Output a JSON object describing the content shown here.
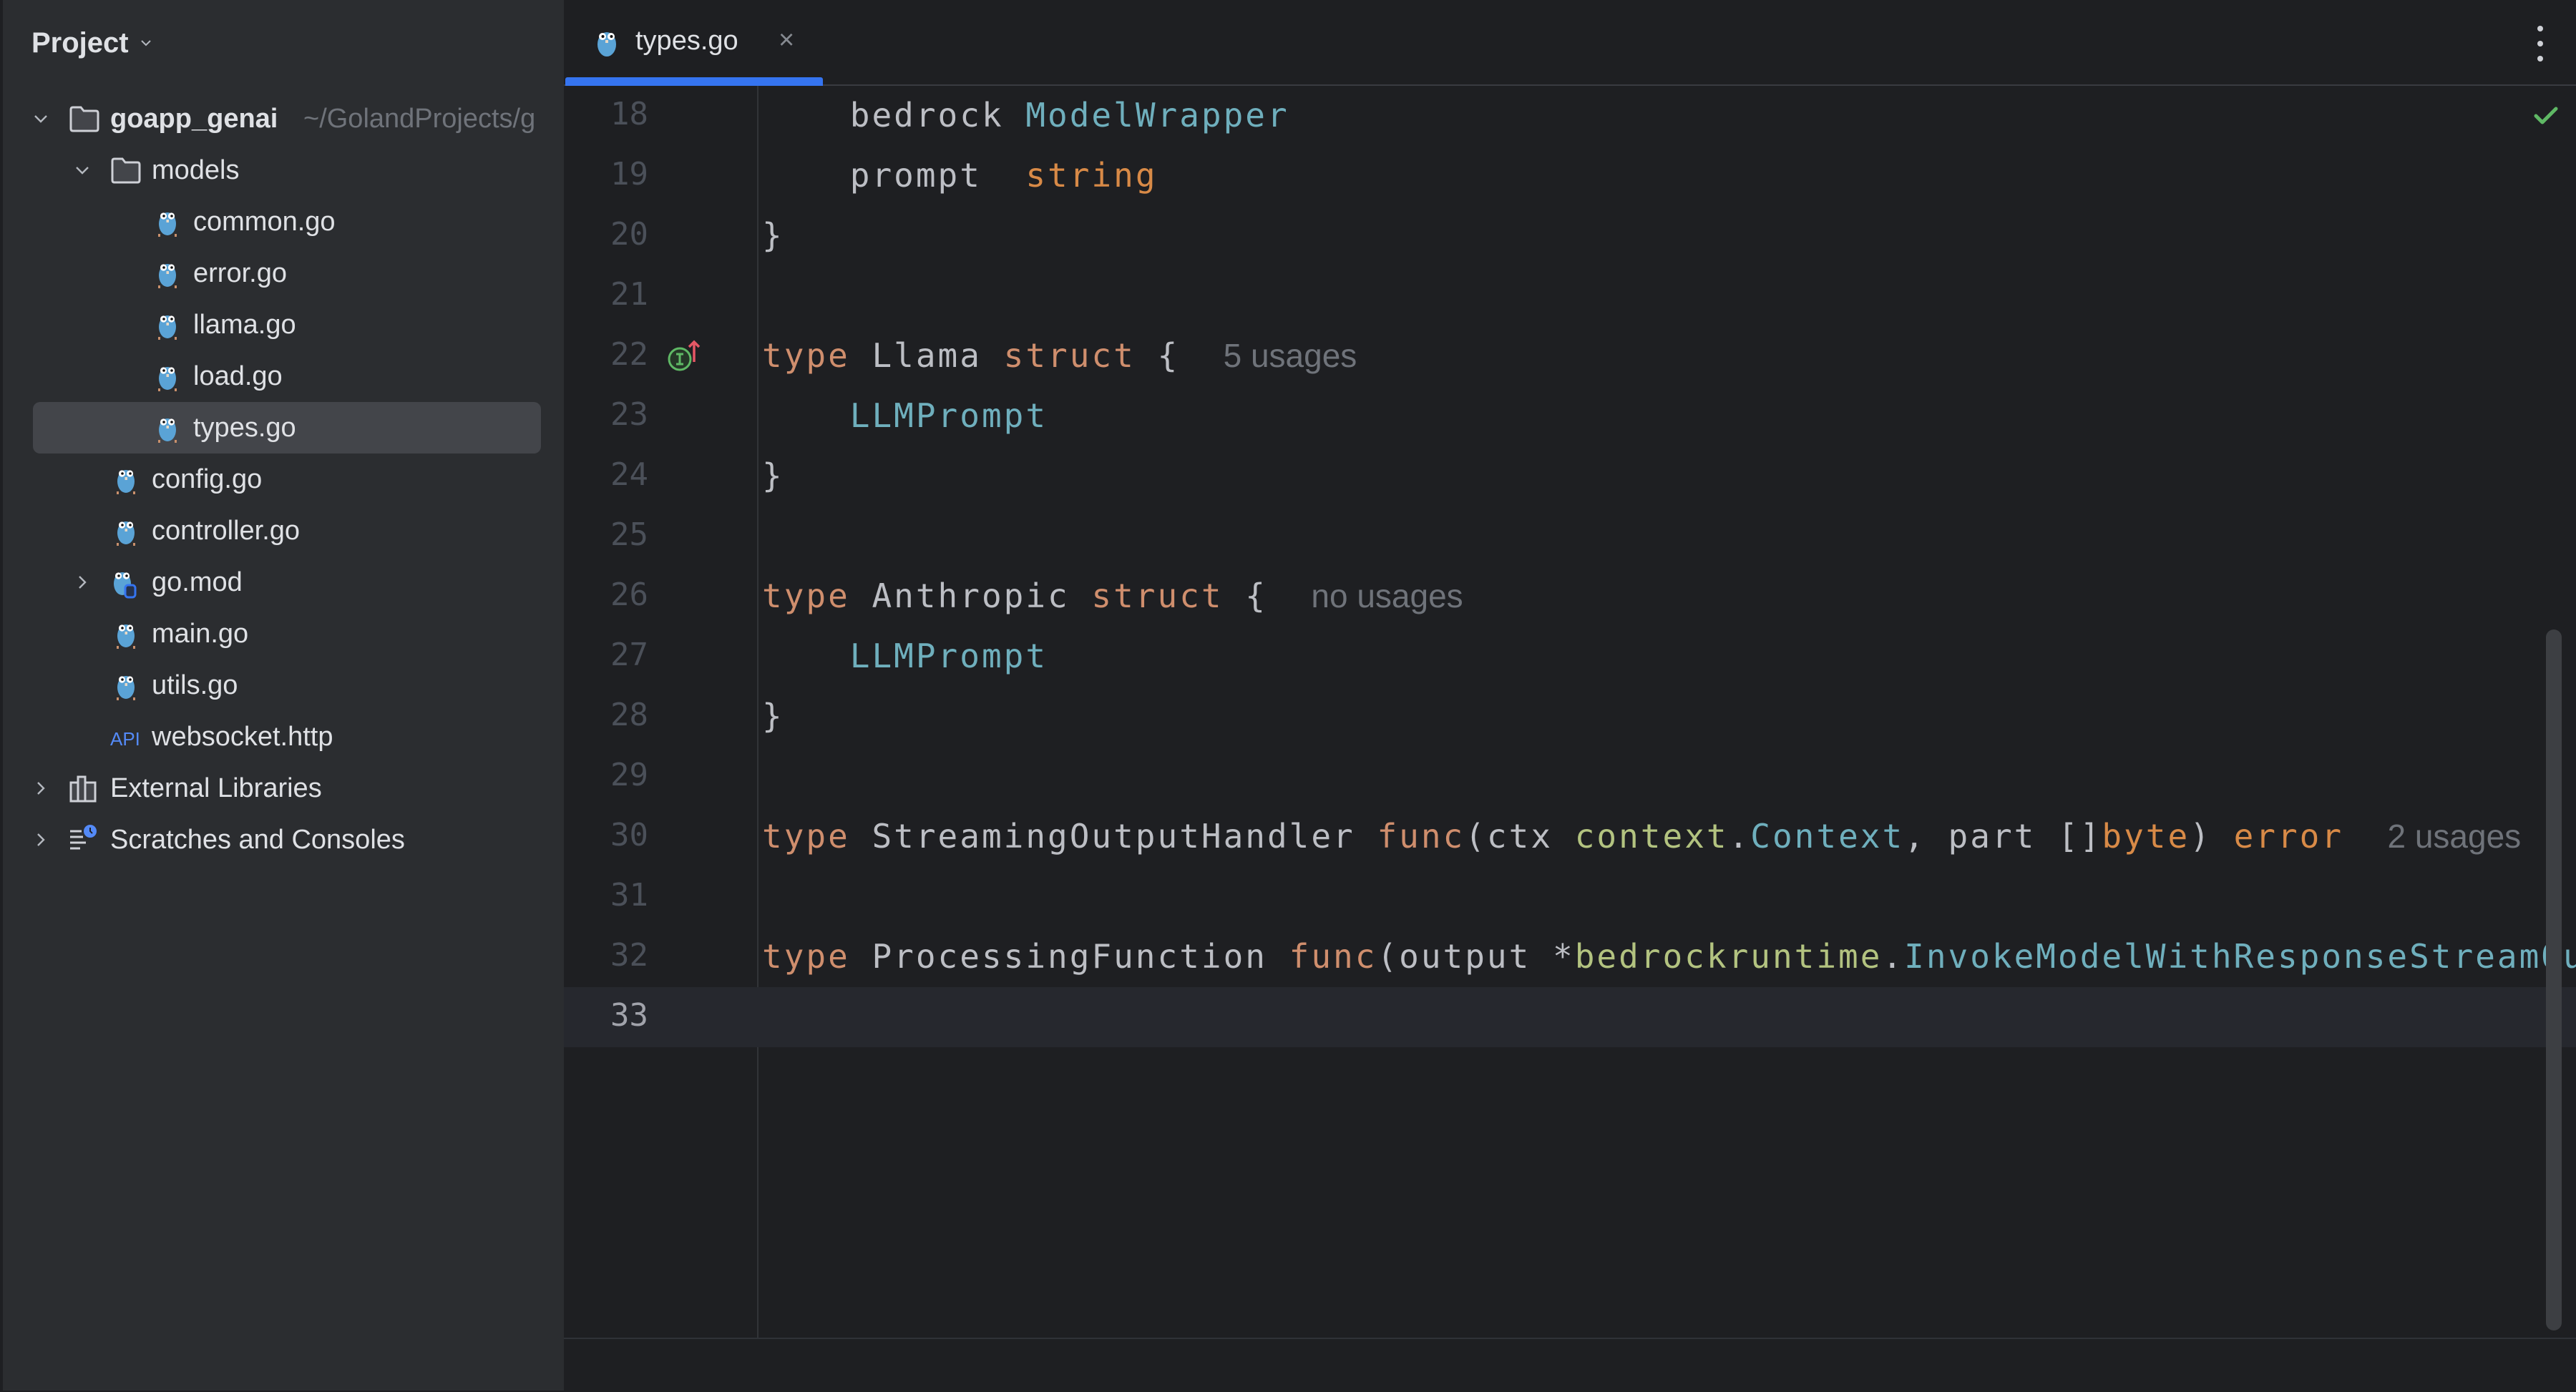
{
  "sidebar": {
    "title": "Project",
    "tree": [
      {
        "label": "goapp_genai",
        "path_hint": "~/GolandProjects/goapp_genai",
        "type": "folder",
        "expanded": true,
        "depth": 0
      },
      {
        "label": "models",
        "type": "folder",
        "expanded": true,
        "depth": 1
      },
      {
        "label": "common.go",
        "type": "go-file",
        "depth": 2
      },
      {
        "label": "error.go",
        "type": "go-file",
        "depth": 2
      },
      {
        "label": "llama.go",
        "type": "go-file",
        "depth": 2
      },
      {
        "label": "load.go",
        "type": "go-file",
        "depth": 2
      },
      {
        "label": "types.go",
        "type": "go-file",
        "depth": 2,
        "selected": true
      },
      {
        "label": "config.go",
        "type": "go-file",
        "depth": 1
      },
      {
        "label": "controller.go",
        "type": "go-file",
        "depth": 1
      },
      {
        "label": "go.mod",
        "type": "go-mod-file",
        "depth": 1,
        "expanded": false
      },
      {
        "label": "main.go",
        "type": "go-file",
        "depth": 1
      },
      {
        "label": "utils.go",
        "type": "go-file",
        "depth": 1
      },
      {
        "label": "websocket.http",
        "type": "http-file",
        "depth": 1
      },
      {
        "label": "External Libraries",
        "type": "library",
        "depth": 0,
        "expanded": false
      },
      {
        "label": "Scratches and Consoles",
        "type": "scratches",
        "depth": 0,
        "expanded": false
      }
    ],
    "root_path": "~/GolandProjects/g"
  },
  "editor": {
    "tab": {
      "label": "types.go",
      "close": "×",
      "active": true
    },
    "inspection_status": "no-problems",
    "lines": [
      {
        "n": "18",
        "tokens": [
          [
            "",
            "    bedrock "
          ],
          [
            "type",
            "ModelWrapper"
          ]
        ]
      },
      {
        "n": "19",
        "tokens": [
          [
            "",
            "    prompt  "
          ],
          [
            "builtin",
            "string"
          ]
        ]
      },
      {
        "n": "20",
        "tokens": [
          [
            "",
            "}"
          ]
        ]
      },
      {
        "n": "21",
        "tokens": []
      },
      {
        "n": "22",
        "tokens": [
          [
            "kw",
            "type"
          ],
          [
            "",
            " Llama "
          ],
          [
            "kw",
            "struct"
          ],
          [
            "",
            " {  "
          ],
          [
            "hint",
            "5 usages"
          ]
        ],
        "gutter": "implemented-overridden"
      },
      {
        "n": "23",
        "tokens": [
          [
            "",
            "    "
          ],
          [
            "type",
            "LLMPrompt"
          ]
        ]
      },
      {
        "n": "24",
        "tokens": [
          [
            "",
            "}"
          ]
        ]
      },
      {
        "n": "25",
        "tokens": []
      },
      {
        "n": "26",
        "tokens": [
          [
            "kw",
            "type"
          ],
          [
            "",
            " Anthropic "
          ],
          [
            "kw",
            "struct"
          ],
          [
            "",
            " {  "
          ],
          [
            "hint",
            "no usages"
          ]
        ]
      },
      {
        "n": "27",
        "tokens": [
          [
            "",
            "    "
          ],
          [
            "type",
            "LLMPrompt"
          ]
        ]
      },
      {
        "n": "28",
        "tokens": [
          [
            "",
            "}"
          ]
        ]
      },
      {
        "n": "29",
        "tokens": []
      },
      {
        "n": "30",
        "tokens": [
          [
            "kw",
            "type"
          ],
          [
            "",
            " StreamingOutputHandler "
          ],
          [
            "kw",
            "func"
          ],
          [
            "",
            "(ctx "
          ],
          [
            "pkg",
            "context"
          ],
          [
            "",
            "."
          ],
          [
            "type",
            "Context"
          ],
          [
            "",
            ", part []"
          ],
          [
            "builtin",
            "byte"
          ],
          [
            "",
            ") "
          ],
          [
            "builtin",
            "error"
          ],
          [
            "",
            "  "
          ],
          [
            "hint",
            "2 usages"
          ]
        ]
      },
      {
        "n": "31",
        "tokens": []
      },
      {
        "n": "32",
        "tokens": [
          [
            "kw",
            "type"
          ],
          [
            "",
            " ProcessingFunction "
          ],
          [
            "kw",
            "func"
          ],
          [
            "",
            "(output *"
          ],
          [
            "pkg",
            "bedrockruntime"
          ],
          [
            "",
            "."
          ],
          [
            "type",
            "InvokeModelWithResponseStreamOutput"
          ]
        ]
      },
      {
        "n": "33",
        "tokens": [],
        "current": true
      }
    ]
  },
  "colors": {
    "accent": "#3574f0",
    "keyword": "#cf8e6d",
    "type": "#6fafbd",
    "package": "#b3c380",
    "builtin": "#d88a47",
    "ok": "#5fb865"
  }
}
